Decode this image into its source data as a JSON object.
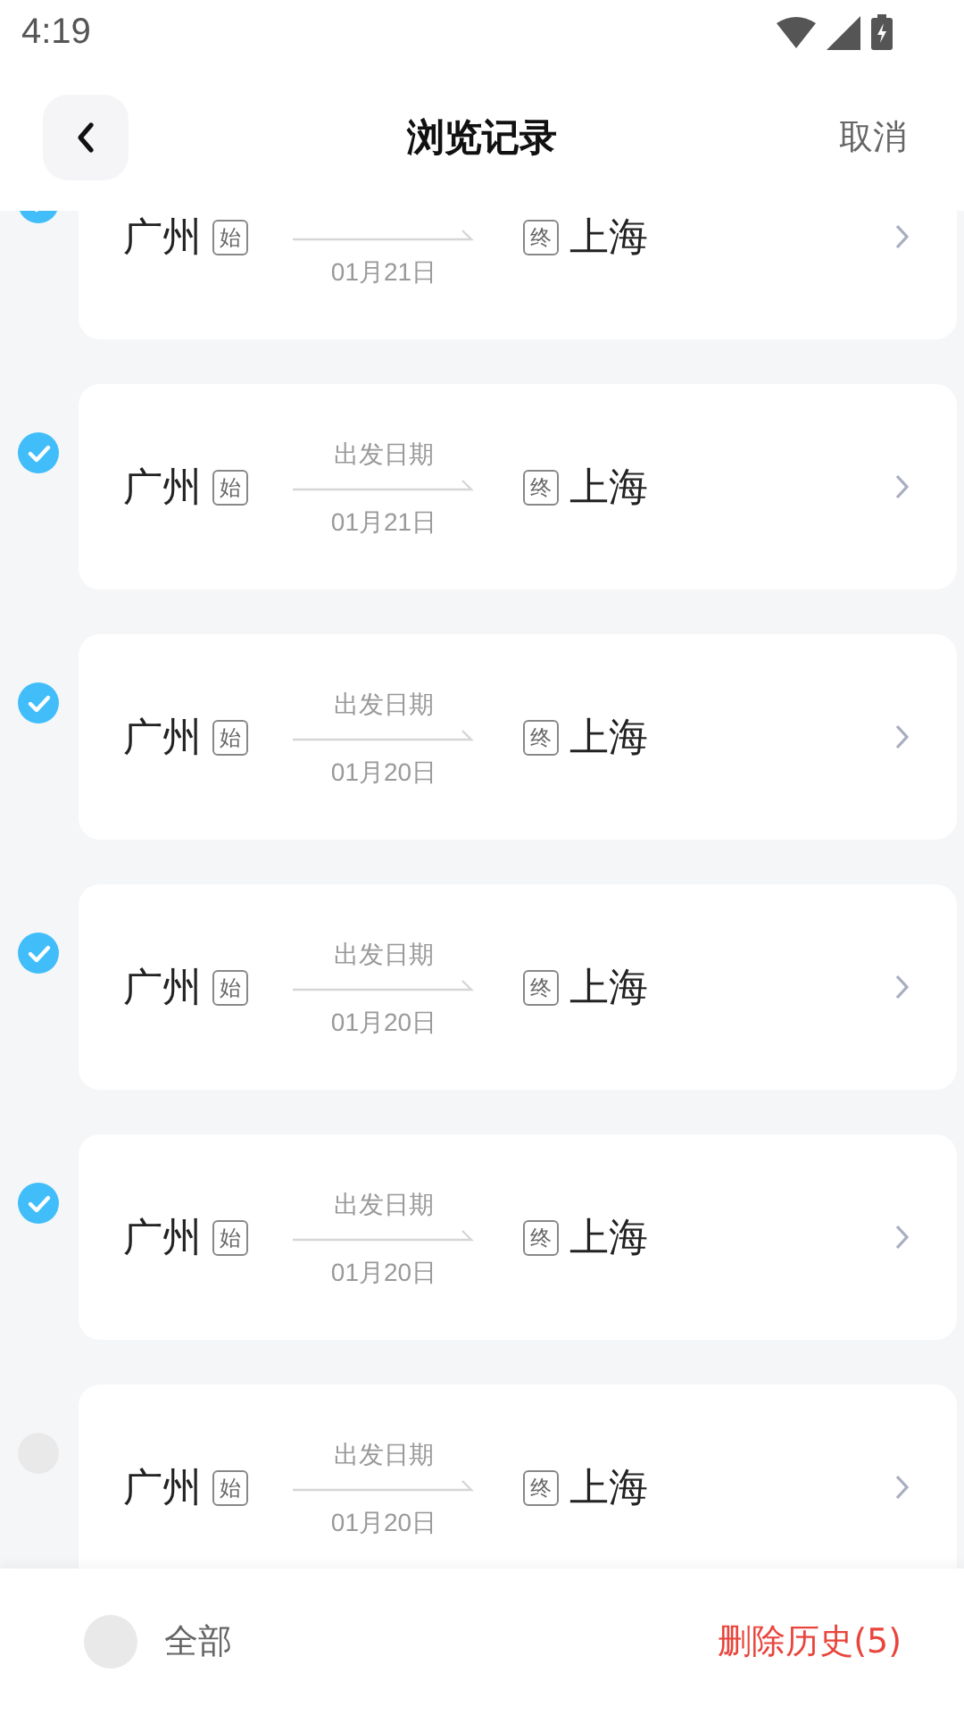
{
  "status_bar": {
    "time": "4:19"
  },
  "header": {
    "title": "浏览记录",
    "action": "取消"
  },
  "records": [
    {
      "from": "广州",
      "from_tag": "始",
      "date": "01月21日",
      "to_tag": "终",
      "to": "上海",
      "selected": true
    },
    {
      "from": "广州",
      "from_tag": "始",
      "date_label": "出发日期",
      "date": "01月21日",
      "to_tag": "终",
      "to": "上海",
      "selected": true
    },
    {
      "from": "广州",
      "from_tag": "始",
      "date_label": "出发日期",
      "date": "01月20日",
      "to_tag": "终",
      "to": "上海",
      "selected": true
    },
    {
      "from": "广州",
      "from_tag": "始",
      "date_label": "出发日期",
      "date": "01月20日",
      "to_tag": "终",
      "to": "上海",
      "selected": true
    },
    {
      "from": "广州",
      "from_tag": "始",
      "date_label": "出发日期",
      "date": "01月20日",
      "to_tag": "终",
      "to": "上海",
      "selected": true
    },
    {
      "from": "广州",
      "from_tag": "始",
      "date_label": "出发日期",
      "date": "01月20日",
      "to_tag": "终",
      "to": "上海",
      "selected": false
    }
  ],
  "footer": {
    "select_all": {
      "label": "全部",
      "selected": false
    },
    "delete_button": "删除历史(5)"
  }
}
